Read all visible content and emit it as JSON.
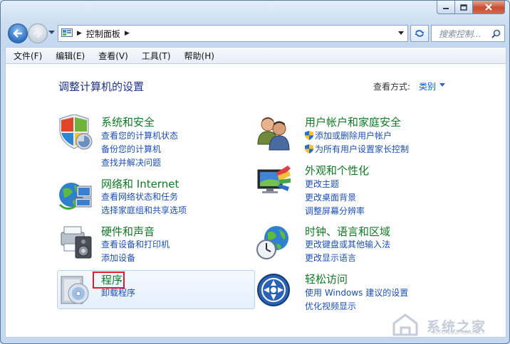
{
  "window": {
    "caption_buttons": [
      "minimize-icon",
      "maximize-icon",
      "close-icon"
    ]
  },
  "nav": {
    "address_crumb": "控制面板",
    "search_placeholder": "搜索控制...",
    "icons": [
      "back-arrow-icon",
      "forward-arrow-icon",
      "recent-pages-chevron-icon",
      "control-panel-icon",
      "refresh-icon",
      "search-icon"
    ]
  },
  "menu": {
    "file": "文件(F)",
    "edit": "编辑(E)",
    "view": "查看(V)",
    "tools": "工具(T)",
    "help": "帮助(H)"
  },
  "page": {
    "title": "调整计算机的设置",
    "view_by_label": "查看方式:",
    "view_by_value": "类别"
  },
  "categories": {
    "system": {
      "heading": "系统和安全",
      "links": [
        "查看您的计算机状态",
        "备份您的计算机",
        "查找并解决问题"
      ]
    },
    "network": {
      "heading": "网络和 Internet",
      "links": [
        "查看网络状态和任务",
        "选择家庭组和共享选项"
      ]
    },
    "hardware": {
      "heading": "硬件和声音",
      "links": [
        "查看设备和打印机",
        "添加设备"
      ]
    },
    "programs": {
      "heading": "程序",
      "links": [
        "卸载程序"
      ]
    },
    "users": {
      "heading": "用户帐户和家庭安全",
      "links": [
        "添加或删除用户帐户",
        "为所有用户设置家长控制"
      ]
    },
    "appearance": {
      "heading": "外观和个性化",
      "links": [
        "更改主题",
        "更改桌面背景",
        "调整屏幕分辨率"
      ]
    },
    "clock": {
      "heading": "时钟、语言和区域",
      "links": [
        "更改键盘或其他输入法",
        "更改显示语言"
      ]
    },
    "ease": {
      "heading": "轻松访问",
      "links": [
        "使用 Windows 建议的设置",
        "优化视频显示"
      ]
    }
  },
  "watermark": {
    "text": "系统之家",
    "subtext": "XITONGZHIJIA.NET"
  },
  "colors": {
    "heading_green": "#0f7a25",
    "link_blue": "#1c4fb7",
    "title_blue": "#1e3287",
    "highlight_red": "#e8192c"
  }
}
